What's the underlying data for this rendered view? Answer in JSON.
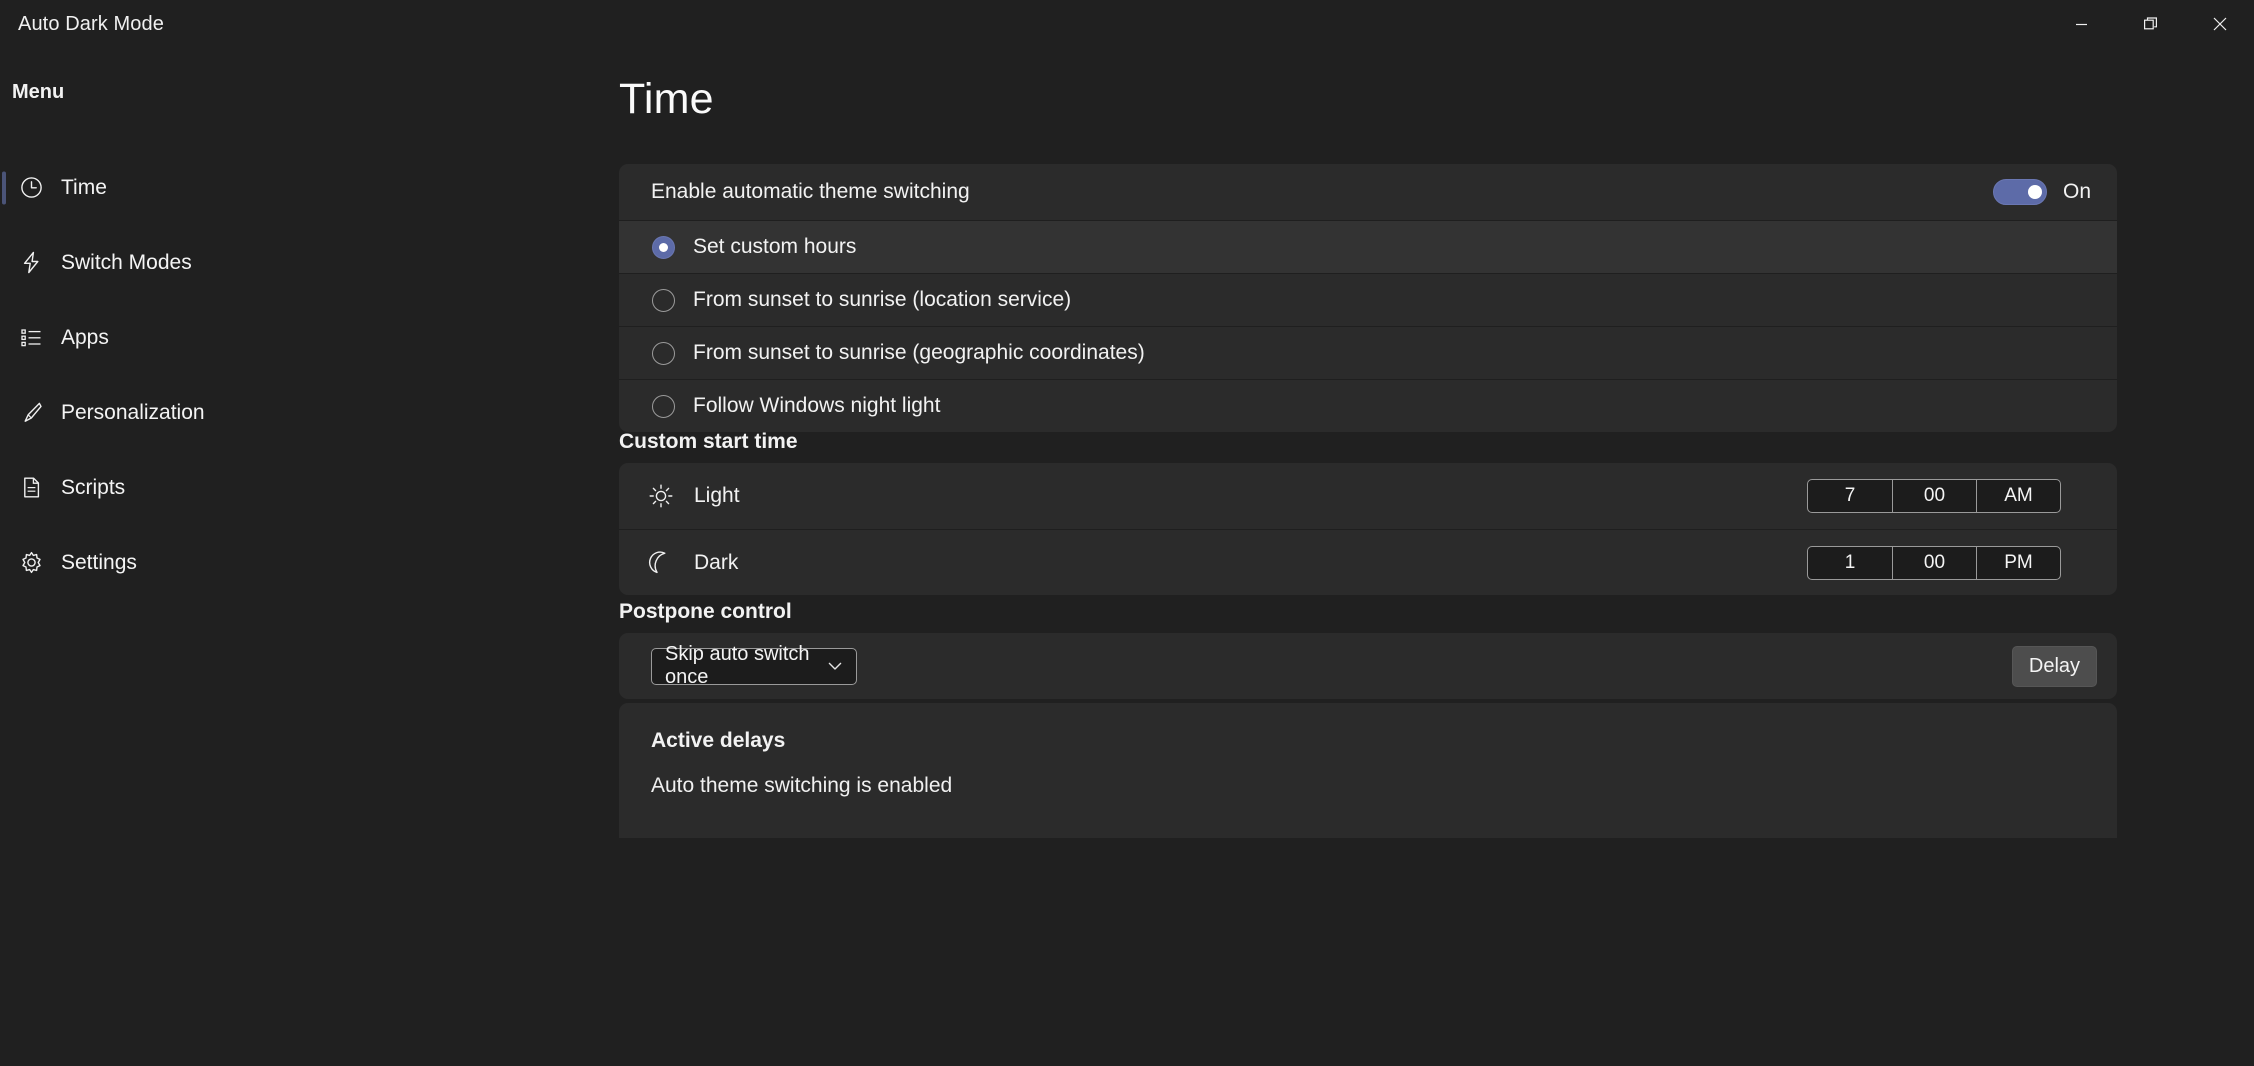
{
  "window": {
    "title": "Auto Dark Mode",
    "controls": [
      {
        "name": "minimize",
        "glyph": "minimize-icon"
      },
      {
        "name": "restore",
        "glyph": "restore-icon"
      },
      {
        "name": "close",
        "glyph": "close-icon"
      }
    ]
  },
  "sidebar": {
    "heading": "Menu",
    "items": [
      {
        "label": "Time",
        "icon": "clock-icon",
        "selected": true
      },
      {
        "label": "Switch Modes",
        "icon": "lightning-icon",
        "selected": false
      },
      {
        "label": "Apps",
        "icon": "list-icon",
        "selected": false
      },
      {
        "label": "Personalization",
        "icon": "brush-icon",
        "selected": false
      },
      {
        "label": "Scripts",
        "icon": "document-icon",
        "selected": false
      },
      {
        "label": "Settings",
        "icon": "gear-icon",
        "selected": false
      }
    ]
  },
  "page": {
    "title": "Time"
  },
  "switching": {
    "label": "Enable automatic theme switching",
    "toggle_state": "On",
    "toggle_on": true,
    "options": [
      {
        "label": "Set custom hours",
        "selected": true
      },
      {
        "label": "From sunset to sunrise (location service)",
        "selected": false
      },
      {
        "label": "From sunset to sunrise (geographic coordinates)",
        "selected": false
      },
      {
        "label": "Follow Windows night light",
        "selected": false
      }
    ]
  },
  "custom_start_time": {
    "section_title": "Custom start time",
    "rows": [
      {
        "label": "Light",
        "icon": "sun-icon",
        "hour": "7",
        "minute": "00",
        "meridiem": "AM"
      },
      {
        "label": "Dark",
        "icon": "moon-icon",
        "hour": "1",
        "minute": "00",
        "meridiem": "PM"
      }
    ]
  },
  "postpone": {
    "section_title": "Postpone control",
    "dropdown_value": "Skip auto switch once",
    "delay_button": "Delay"
  },
  "active_delays": {
    "title": "Active delays",
    "status": "Auto theme switching is enabled"
  },
  "colors": {
    "page_bg": "#202020",
    "card_bg": "#2b2b2b",
    "row_selected_bg": "#333333",
    "accent": "#5d6ba8",
    "accent_indicator": "#4b5478",
    "button_bg": "#4d4d4d",
    "text": "#f2f2f2"
  }
}
